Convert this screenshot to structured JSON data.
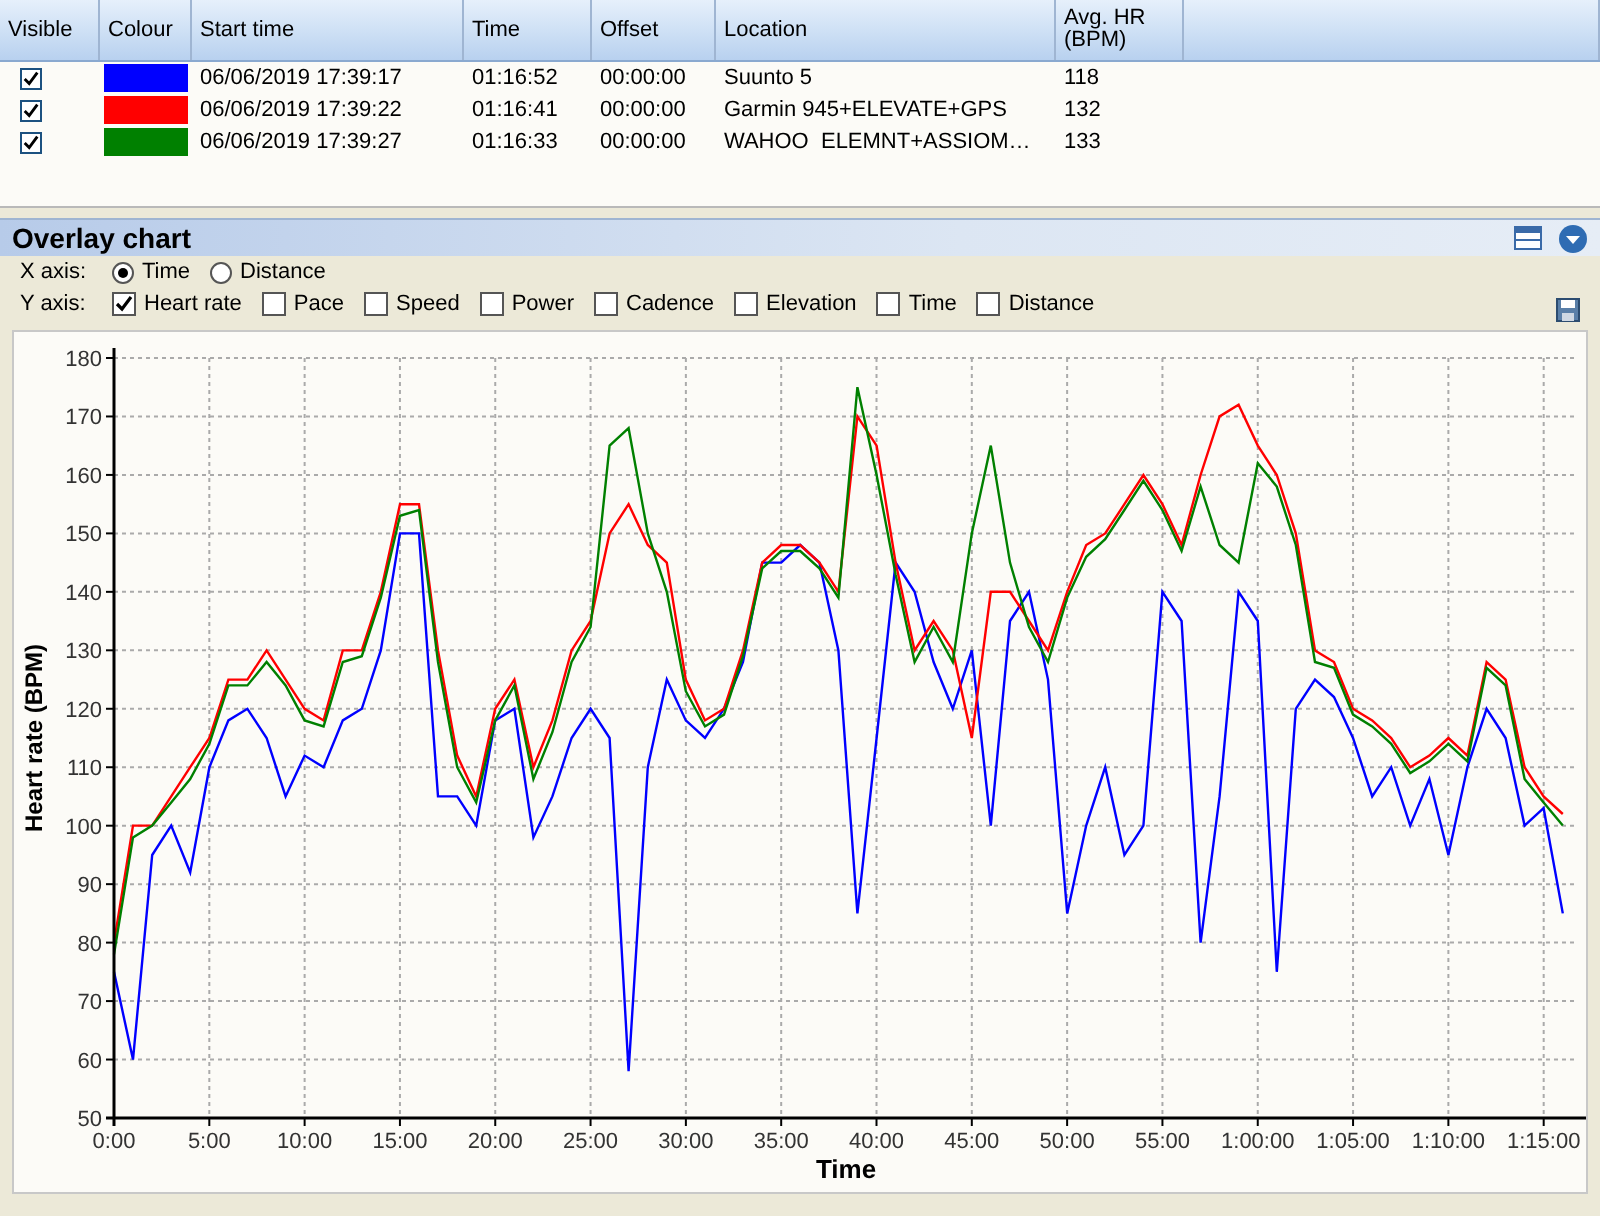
{
  "table": {
    "columns": [
      "Visible",
      "Colour",
      "Start time",
      "Time",
      "Offset",
      "Location",
      "Avg. HR (BPM)"
    ],
    "rows": [
      {
        "visible": true,
        "color": "#0000ff",
        "start_time": "06/06/2019 17:39:17",
        "time": "01:16:52",
        "offset": "00:00:00",
        "location": "Suunto 5",
        "avg_hr": "118"
      },
      {
        "visible": true,
        "color": "#ff0000",
        "start_time": "06/06/2019 17:39:22",
        "time": "01:16:41",
        "offset": "00:00:00",
        "location": "Garmin 945+ELEVATE+GPS",
        "avg_hr": "132"
      },
      {
        "visible": true,
        "color": "#008000",
        "start_time": "06/06/2019 17:39:27",
        "time": "01:16:33",
        "offset": "00:00:00",
        "location": "WAHOO  ELEMNT+ASSIOM…",
        "avg_hr": "133"
      }
    ]
  },
  "panel": {
    "title": "Overlay chart",
    "x_axis": {
      "label": "X axis:",
      "options": [
        {
          "label": "Time",
          "selected": true
        },
        {
          "label": "Distance",
          "selected": false
        }
      ]
    },
    "y_axis": {
      "label": "Y axis:",
      "options": [
        {
          "label": "Heart rate",
          "checked": true
        },
        {
          "label": "Pace",
          "checked": false
        },
        {
          "label": "Speed",
          "checked": false
        },
        {
          "label": "Power",
          "checked": false
        },
        {
          "label": "Cadence",
          "checked": false
        },
        {
          "label": "Elevation",
          "checked": false
        },
        {
          "label": "Time",
          "checked": false
        },
        {
          "label": "Distance",
          "checked": false
        }
      ]
    },
    "chart_data": {
      "type": "line",
      "xlabel": "Time",
      "ylabel": "Heart rate (BPM)",
      "x": [
        0,
        1,
        2,
        3,
        4,
        5,
        6,
        7,
        8,
        9,
        10,
        11,
        12,
        13,
        14,
        15,
        16,
        17,
        18,
        19,
        20,
        21,
        22,
        23,
        24,
        25,
        26,
        27,
        28,
        29,
        30,
        31,
        32,
        33,
        34,
        35,
        36,
        37,
        38,
        39,
        40,
        41,
        42,
        43,
        44,
        45,
        46,
        47,
        48,
        49,
        50,
        51,
        52,
        53,
        54,
        55,
        56,
        57,
        58,
        59,
        60,
        61,
        62,
        63,
        64,
        65,
        66,
        67,
        68,
        69,
        70,
        71,
        72,
        73,
        74,
        75,
        76
      ],
      "series": [
        {
          "color": "#0000ff",
          "values": [
            75,
            60,
            95,
            100,
            92,
            110,
            118,
            120,
            115,
            105,
            112,
            110,
            118,
            120,
            130,
            150,
            150,
            105,
            105,
            100,
            118,
            120,
            98,
            105,
            115,
            120,
            115,
            58,
            110,
            125,
            118,
            115,
            120,
            128,
            145,
            145,
            148,
            145,
            130,
            85,
            115,
            145,
            140,
            128,
            120,
            130,
            100,
            135,
            140,
            125,
            85,
            100,
            110,
            95,
            100,
            140,
            135,
            80,
            105,
            140,
            135,
            75,
            120,
            125,
            122,
            115,
            105,
            110,
            100,
            108,
            95,
            110,
            120,
            115,
            100,
            103,
            85
          ]
        },
        {
          "color": "#ff0000",
          "values": [
            80,
            100,
            100,
            105,
            110,
            115,
            125,
            125,
            130,
            125,
            120,
            118,
            130,
            130,
            140,
            155,
            155,
            130,
            112,
            105,
            120,
            125,
            110,
            118,
            130,
            135,
            150,
            155,
            148,
            145,
            125,
            118,
            120,
            130,
            145,
            148,
            148,
            145,
            140,
            170,
            165,
            145,
            130,
            135,
            130,
            115,
            140,
            140,
            135,
            130,
            140,
            148,
            150,
            155,
            160,
            155,
            148,
            160,
            170,
            172,
            165,
            160,
            150,
            130,
            128,
            120,
            118,
            115,
            110,
            112,
            115,
            112,
            128,
            125,
            110,
            105,
            102
          ]
        },
        {
          "color": "#008000",
          "values": [
            78,
            98,
            100,
            104,
            108,
            114,
            124,
            124,
            128,
            124,
            118,
            117,
            128,
            129,
            139,
            153,
            154,
            128,
            110,
            104,
            118,
            124,
            108,
            116,
            128,
            134,
            165,
            168,
            150,
            140,
            123,
            117,
            119,
            129,
            144,
            147,
            147,
            144,
            139,
            175,
            160,
            143,
            128,
            134,
            128,
            150,
            165,
            145,
            134,
            128,
            139,
            146,
            149,
            154,
            159,
            154,
            147,
            158,
            148,
            145,
            162,
            158,
            148,
            128,
            127,
            119,
            117,
            114,
            109,
            111,
            114,
            111,
            127,
            124,
            108,
            104,
            100
          ]
        }
      ],
      "grid": true,
      "xlim": [
        0,
        76.8
      ],
      "ylim": [
        50,
        180
      ],
      "xticks": [
        {
          "value": 0,
          "label": "0:00"
        },
        {
          "value": 5,
          "label": "5:00"
        },
        {
          "value": 10,
          "label": "10:00"
        },
        {
          "value": 15,
          "label": "15:00"
        },
        {
          "value": 20,
          "label": "20:00"
        },
        {
          "value": 25,
          "label": "25:00"
        },
        {
          "value": 30,
          "label": "30:00"
        },
        {
          "value": 35,
          "label": "35:00"
        },
        {
          "value": 40,
          "label": "40:00"
        },
        {
          "value": 45,
          "label": "45:00"
        },
        {
          "value": 50,
          "label": "50:00"
        },
        {
          "value": 55,
          "label": "55:00"
        },
        {
          "value": 60,
          "label": "1:00:00"
        },
        {
          "value": 65,
          "label": "1:05:00"
        },
        {
          "value": 70,
          "label": "1:10:00"
        },
        {
          "value": 75,
          "label": "1:15:00"
        }
      ],
      "yticks": [
        50,
        60,
        70,
        80,
        90,
        100,
        110,
        120,
        130,
        140,
        150,
        160,
        170,
        180
      ]
    }
  }
}
